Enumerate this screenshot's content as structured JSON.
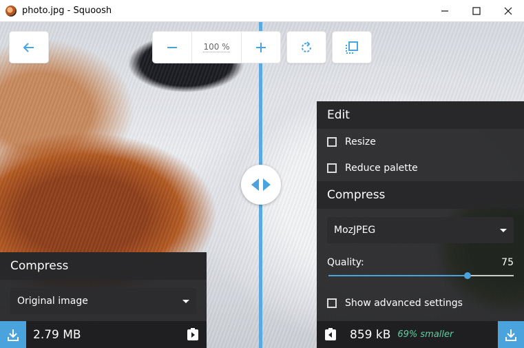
{
  "window": {
    "title": "photo.jpg - Squoosh"
  },
  "toolbar": {
    "zoom_value": "100",
    "zoom_unit": "%"
  },
  "left": {
    "compress_heading": "Compress",
    "method_selected": "Original image",
    "size": "2.79 MB"
  },
  "right": {
    "edit_heading": "Edit",
    "resize_label": "Resize",
    "reduce_palette_label": "Reduce palette",
    "compress_heading": "Compress",
    "method_selected": "MozJPEG",
    "quality_label": "Quality:",
    "quality_value": "75",
    "quality_fraction": 0.75,
    "advanced_label": "Show advanced settings",
    "size": "859 kB",
    "savings": "69% smaller"
  },
  "colors": {
    "accent": "#4aa3dd",
    "savings": "#5fd0a0",
    "panel": "#1f1f21"
  }
}
